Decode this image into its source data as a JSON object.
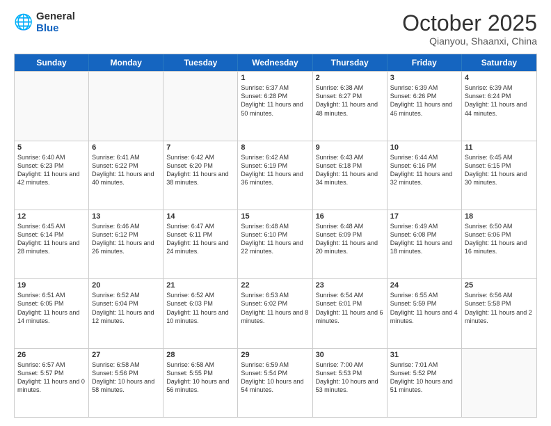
{
  "logo": {
    "general": "General",
    "blue": "Blue"
  },
  "title": "October 2025",
  "location": "Qianyou, Shaanxi, China",
  "days": [
    "Sunday",
    "Monday",
    "Tuesday",
    "Wednesday",
    "Thursday",
    "Friday",
    "Saturday"
  ],
  "weeks": [
    [
      {
        "day": "",
        "empty": true
      },
      {
        "day": "",
        "empty": true
      },
      {
        "day": "",
        "empty": true
      },
      {
        "day": "1",
        "sunrise": "6:37 AM",
        "sunset": "6:28 PM",
        "daylight": "11 hours and 50 minutes."
      },
      {
        "day": "2",
        "sunrise": "6:38 AM",
        "sunset": "6:27 PM",
        "daylight": "11 hours and 48 minutes."
      },
      {
        "day": "3",
        "sunrise": "6:39 AM",
        "sunset": "6:26 PM",
        "daylight": "11 hours and 46 minutes."
      },
      {
        "day": "4",
        "sunrise": "6:39 AM",
        "sunset": "6:24 PM",
        "daylight": "11 hours and 44 minutes."
      }
    ],
    [
      {
        "day": "5",
        "sunrise": "6:40 AM",
        "sunset": "6:23 PM",
        "daylight": "11 hours and 42 minutes."
      },
      {
        "day": "6",
        "sunrise": "6:41 AM",
        "sunset": "6:22 PM",
        "daylight": "11 hours and 40 minutes."
      },
      {
        "day": "7",
        "sunrise": "6:42 AM",
        "sunset": "6:20 PM",
        "daylight": "11 hours and 38 minutes."
      },
      {
        "day": "8",
        "sunrise": "6:42 AM",
        "sunset": "6:19 PM",
        "daylight": "11 hours and 36 minutes."
      },
      {
        "day": "9",
        "sunrise": "6:43 AM",
        "sunset": "6:18 PM",
        "daylight": "11 hours and 34 minutes."
      },
      {
        "day": "10",
        "sunrise": "6:44 AM",
        "sunset": "6:16 PM",
        "daylight": "11 hours and 32 minutes."
      },
      {
        "day": "11",
        "sunrise": "6:45 AM",
        "sunset": "6:15 PM",
        "daylight": "11 hours and 30 minutes."
      }
    ],
    [
      {
        "day": "12",
        "sunrise": "6:45 AM",
        "sunset": "6:14 PM",
        "daylight": "11 hours and 28 minutes."
      },
      {
        "day": "13",
        "sunrise": "6:46 AM",
        "sunset": "6:12 PM",
        "daylight": "11 hours and 26 minutes."
      },
      {
        "day": "14",
        "sunrise": "6:47 AM",
        "sunset": "6:11 PM",
        "daylight": "11 hours and 24 minutes."
      },
      {
        "day": "15",
        "sunrise": "6:48 AM",
        "sunset": "6:10 PM",
        "daylight": "11 hours and 22 minutes."
      },
      {
        "day": "16",
        "sunrise": "6:48 AM",
        "sunset": "6:09 PM",
        "daylight": "11 hours and 20 minutes."
      },
      {
        "day": "17",
        "sunrise": "6:49 AM",
        "sunset": "6:08 PM",
        "daylight": "11 hours and 18 minutes."
      },
      {
        "day": "18",
        "sunrise": "6:50 AM",
        "sunset": "6:06 PM",
        "daylight": "11 hours and 16 minutes."
      }
    ],
    [
      {
        "day": "19",
        "sunrise": "6:51 AM",
        "sunset": "6:05 PM",
        "daylight": "11 hours and 14 minutes."
      },
      {
        "day": "20",
        "sunrise": "6:52 AM",
        "sunset": "6:04 PM",
        "daylight": "11 hours and 12 minutes."
      },
      {
        "day": "21",
        "sunrise": "6:52 AM",
        "sunset": "6:03 PM",
        "daylight": "11 hours and 10 minutes."
      },
      {
        "day": "22",
        "sunrise": "6:53 AM",
        "sunset": "6:02 PM",
        "daylight": "11 hours and 8 minutes."
      },
      {
        "day": "23",
        "sunrise": "6:54 AM",
        "sunset": "6:01 PM",
        "daylight": "11 hours and 6 minutes."
      },
      {
        "day": "24",
        "sunrise": "6:55 AM",
        "sunset": "5:59 PM",
        "daylight": "11 hours and 4 minutes."
      },
      {
        "day": "25",
        "sunrise": "6:56 AM",
        "sunset": "5:58 PM",
        "daylight": "11 hours and 2 minutes."
      }
    ],
    [
      {
        "day": "26",
        "sunrise": "6:57 AM",
        "sunset": "5:57 PM",
        "daylight": "11 hours and 0 minutes."
      },
      {
        "day": "27",
        "sunrise": "6:58 AM",
        "sunset": "5:56 PM",
        "daylight": "10 hours and 58 minutes."
      },
      {
        "day": "28",
        "sunrise": "6:58 AM",
        "sunset": "5:55 PM",
        "daylight": "10 hours and 56 minutes."
      },
      {
        "day": "29",
        "sunrise": "6:59 AM",
        "sunset": "5:54 PM",
        "daylight": "10 hours and 54 minutes."
      },
      {
        "day": "30",
        "sunrise": "7:00 AM",
        "sunset": "5:53 PM",
        "daylight": "10 hours and 53 minutes."
      },
      {
        "day": "31",
        "sunrise": "7:01 AM",
        "sunset": "5:52 PM",
        "daylight": "10 hours and 51 minutes."
      },
      {
        "day": "",
        "empty": true
      }
    ]
  ]
}
